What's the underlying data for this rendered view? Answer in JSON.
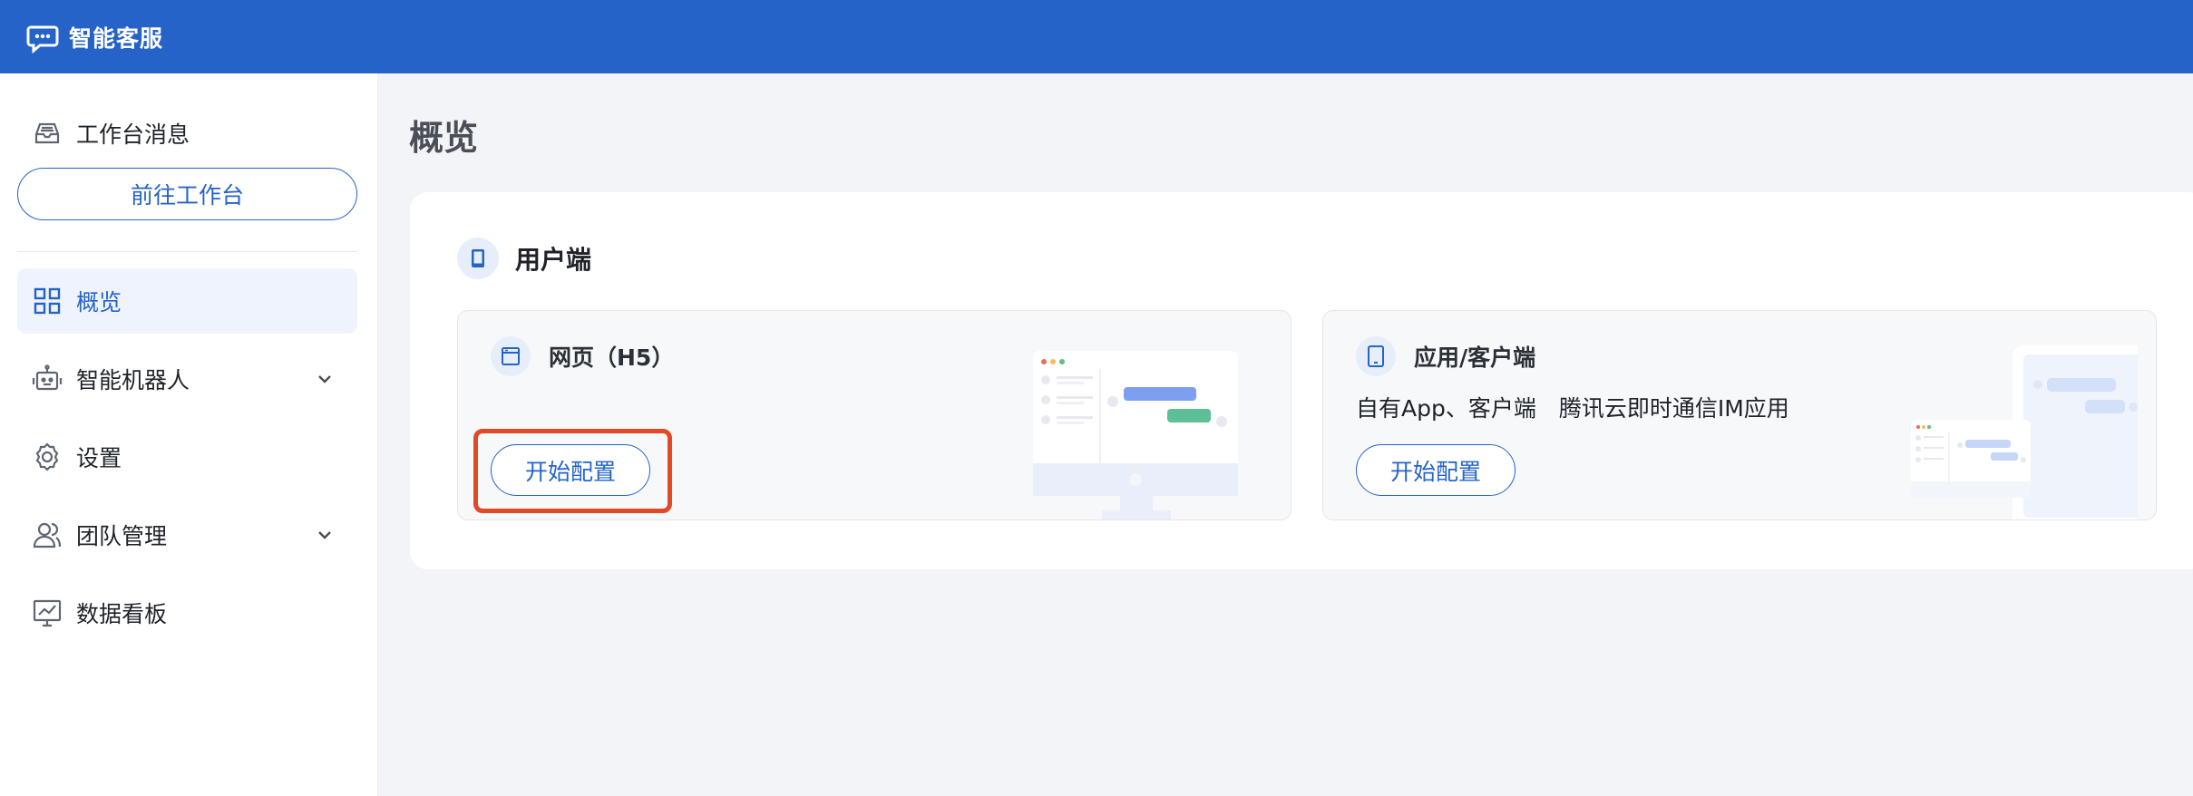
{
  "header": {
    "app_title": "智能客服"
  },
  "sidebar": {
    "workspace_label": "工作台消息",
    "goto_button": "前往工作台",
    "items": [
      {
        "label": "概览",
        "active": true
      },
      {
        "label": "智能机器人",
        "expandable": true
      },
      {
        "label": "设置"
      },
      {
        "label": "团队管理",
        "expandable": true
      },
      {
        "label": "数据看板"
      }
    ]
  },
  "main": {
    "page_title": "概览",
    "section_title": "用户端",
    "cards": [
      {
        "title": "网页（H5）",
        "desc": "",
        "button": "开始配置",
        "highlighted": true
      },
      {
        "title": "应用/客户端",
        "desc": "自有App、客户端　腾讯云即时通信IM应用",
        "button": "开始配置"
      }
    ]
  },
  "colors": {
    "brand": "#2563c9",
    "highlight": "#e04a26",
    "active_bg": "#eef3fd"
  }
}
